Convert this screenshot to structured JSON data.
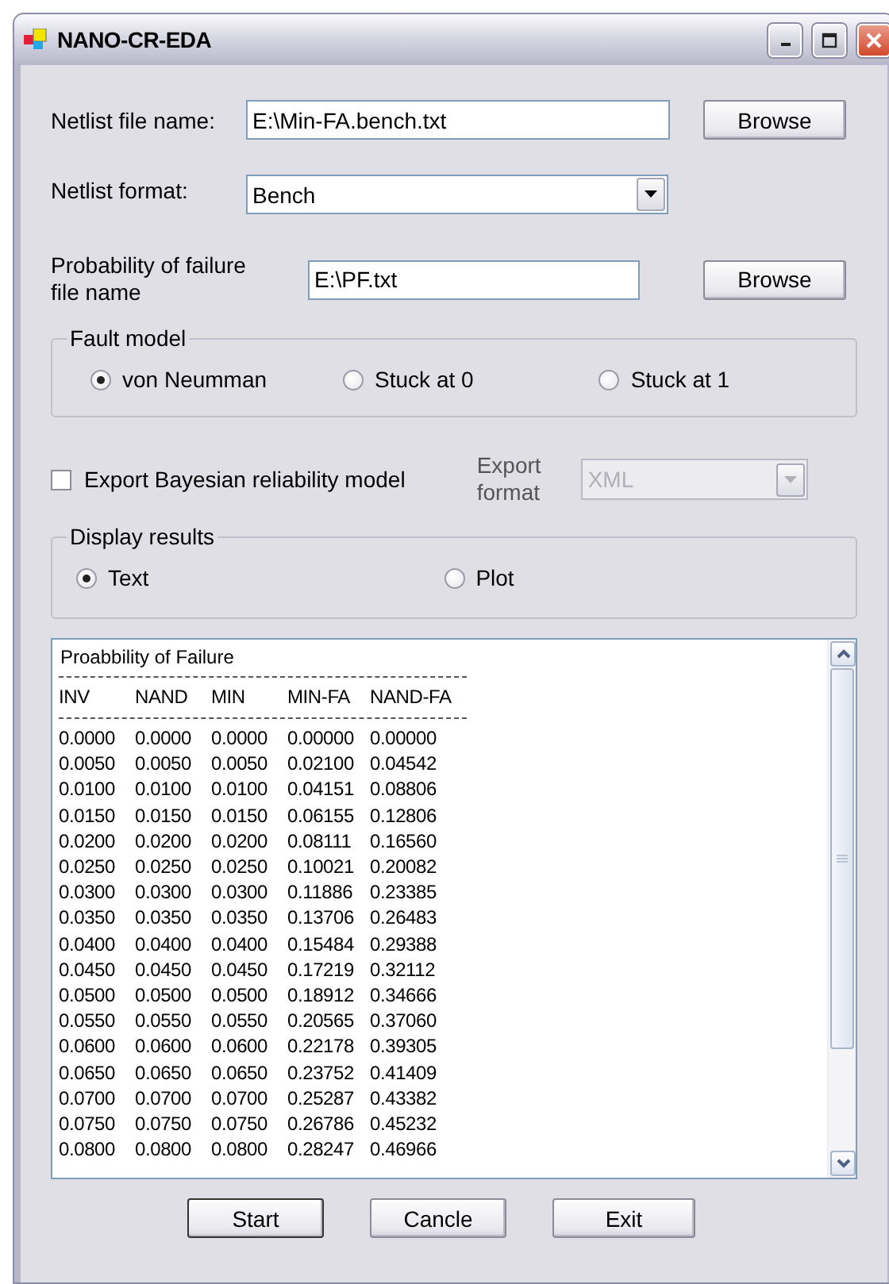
{
  "window": {
    "title": "NANO-CR-EDA"
  },
  "netlist_file": {
    "label": "Netlist file name:",
    "value": "E:\\Min-FA.bench.txt",
    "button": "Browse"
  },
  "netlist_format": {
    "label": "Netlist format:",
    "value": "Bench"
  },
  "pf_file": {
    "label": "Probability of failure file name",
    "value": "E:\\PF.txt",
    "button": "Browse"
  },
  "fault_model": {
    "legend": "Fault model",
    "options": [
      {
        "label": "von Neumman",
        "selected": true
      },
      {
        "label": "Stuck at 0",
        "selected": false
      },
      {
        "label": "Stuck at 1",
        "selected": false
      }
    ]
  },
  "export": {
    "label": "Export Bayesian reliability model",
    "checked": false
  },
  "export_format": {
    "label": "Export format",
    "value": "XML",
    "disabled": true
  },
  "display_results": {
    "legend": "Display results",
    "options": [
      {
        "label": "Text",
        "selected": true
      },
      {
        "label": "Plot",
        "selected": false
      }
    ]
  },
  "results": {
    "title": "Proabbility of Failure",
    "columns": [
      "INV",
      "NAND",
      "MIN",
      "MIN-FA",
      "NAND-FA"
    ],
    "rows": [
      [
        "0.0000",
        "0.0000",
        "0.0000",
        "0.00000",
        "0.00000"
      ],
      [
        "0.0050",
        "0.0050",
        "0.0050",
        "0.02100",
        "0.04542"
      ],
      [
        "0.0100",
        "0.0100",
        "0.0100",
        "0.04151",
        "0.08806"
      ],
      [
        "0.0150",
        "0.0150",
        "0.0150",
        "0.06155",
        "0.12806"
      ],
      [
        "0.0200",
        "0.0200",
        "0.0200",
        "0.08111",
        "0.16560"
      ],
      [
        "0.0250",
        "0.0250",
        "0.0250",
        "0.10021",
        "0.20082"
      ],
      [
        "0.0300",
        "0.0300",
        "0.0300",
        "0.11886",
        "0.23385"
      ],
      [
        "0.0350",
        "0.0350",
        "0.0350",
        "0.13706",
        "0.26483"
      ],
      [
        "0.0400",
        "0.0400",
        "0.0400",
        "0.15484",
        "0.29388"
      ],
      [
        "0.0450",
        "0.0450",
        "0.0450",
        "0.17219",
        "0.32112"
      ],
      [
        "0.0500",
        "0.0500",
        "0.0500",
        "0.18912",
        "0.34666"
      ],
      [
        "0.0550",
        "0.0550",
        "0.0550",
        "0.20565",
        "0.37060"
      ],
      [
        "0.0600",
        "0.0600",
        "0.0600",
        "0.22178",
        "0.39305"
      ],
      [
        "0.0650",
        "0.0650",
        "0.0650",
        "0.23752",
        "0.41409"
      ],
      [
        "0.0700",
        "0.0700",
        "0.0700",
        "0.25287",
        "0.43382"
      ],
      [
        "0.0750",
        "0.0750",
        "0.0750",
        "0.26786",
        "0.45232"
      ],
      [
        "0.0800",
        "0.0800",
        "0.0800",
        "0.28247",
        "0.46966"
      ]
    ]
  },
  "buttons": [
    "Start",
    "Cancle",
    "Exit"
  ]
}
